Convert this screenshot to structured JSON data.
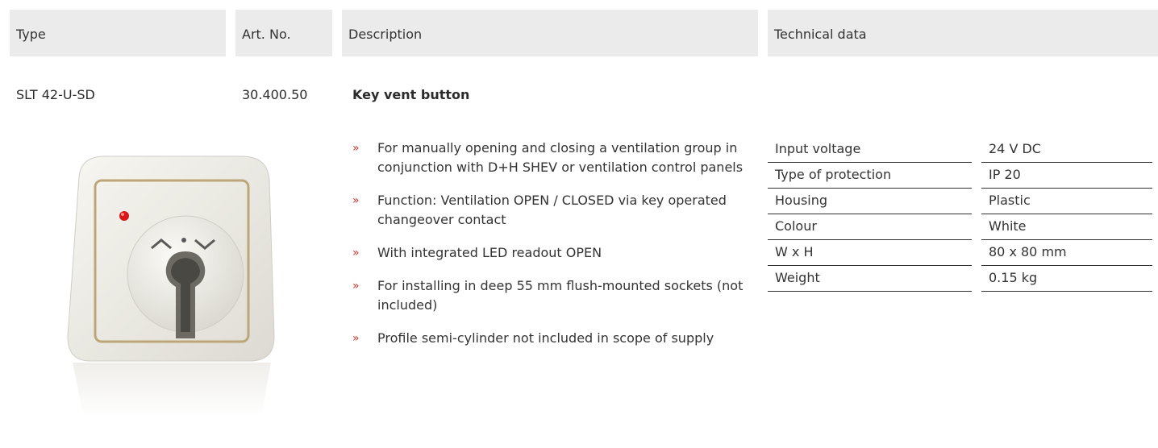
{
  "header": {
    "type": "Type",
    "art_no": "Art. No.",
    "description": "Description",
    "technical": "Technical data"
  },
  "product": {
    "type": "SLT 42-U-SD",
    "art_no": "30.400.50",
    "title": "Key vent button",
    "image_icon": "key-switch-product-photo"
  },
  "bullets": [
    "For manually opening and closing a ventilation group in conjunction with D+H SHEV or ventilation control panels",
    "Function: Ventilation OPEN / CLOSED via key operated changeover contact",
    "With integrated LED readout OPEN",
    "For installing in deep 55 mm flush-mounted sockets (not included)",
    "Profile semi-cylinder not included in scope of supply"
  ],
  "bullet_marker": "»",
  "tech": [
    {
      "key": "Input voltage",
      "value": "24 V DC"
    },
    {
      "key": "Type of protection",
      "value": "IP 20"
    },
    {
      "key": "Housing",
      "value": "Plastic"
    },
    {
      "key": "Colour",
      "value": "White"
    },
    {
      "key": "W x H",
      "value": "80 x 80 mm"
    },
    {
      "key": "Weight",
      "value": "0.15 kg"
    }
  ],
  "colors": {
    "header_bg": "#ebebeb",
    "bullet_marker": "#c0362c",
    "led": "#d61a1a"
  }
}
